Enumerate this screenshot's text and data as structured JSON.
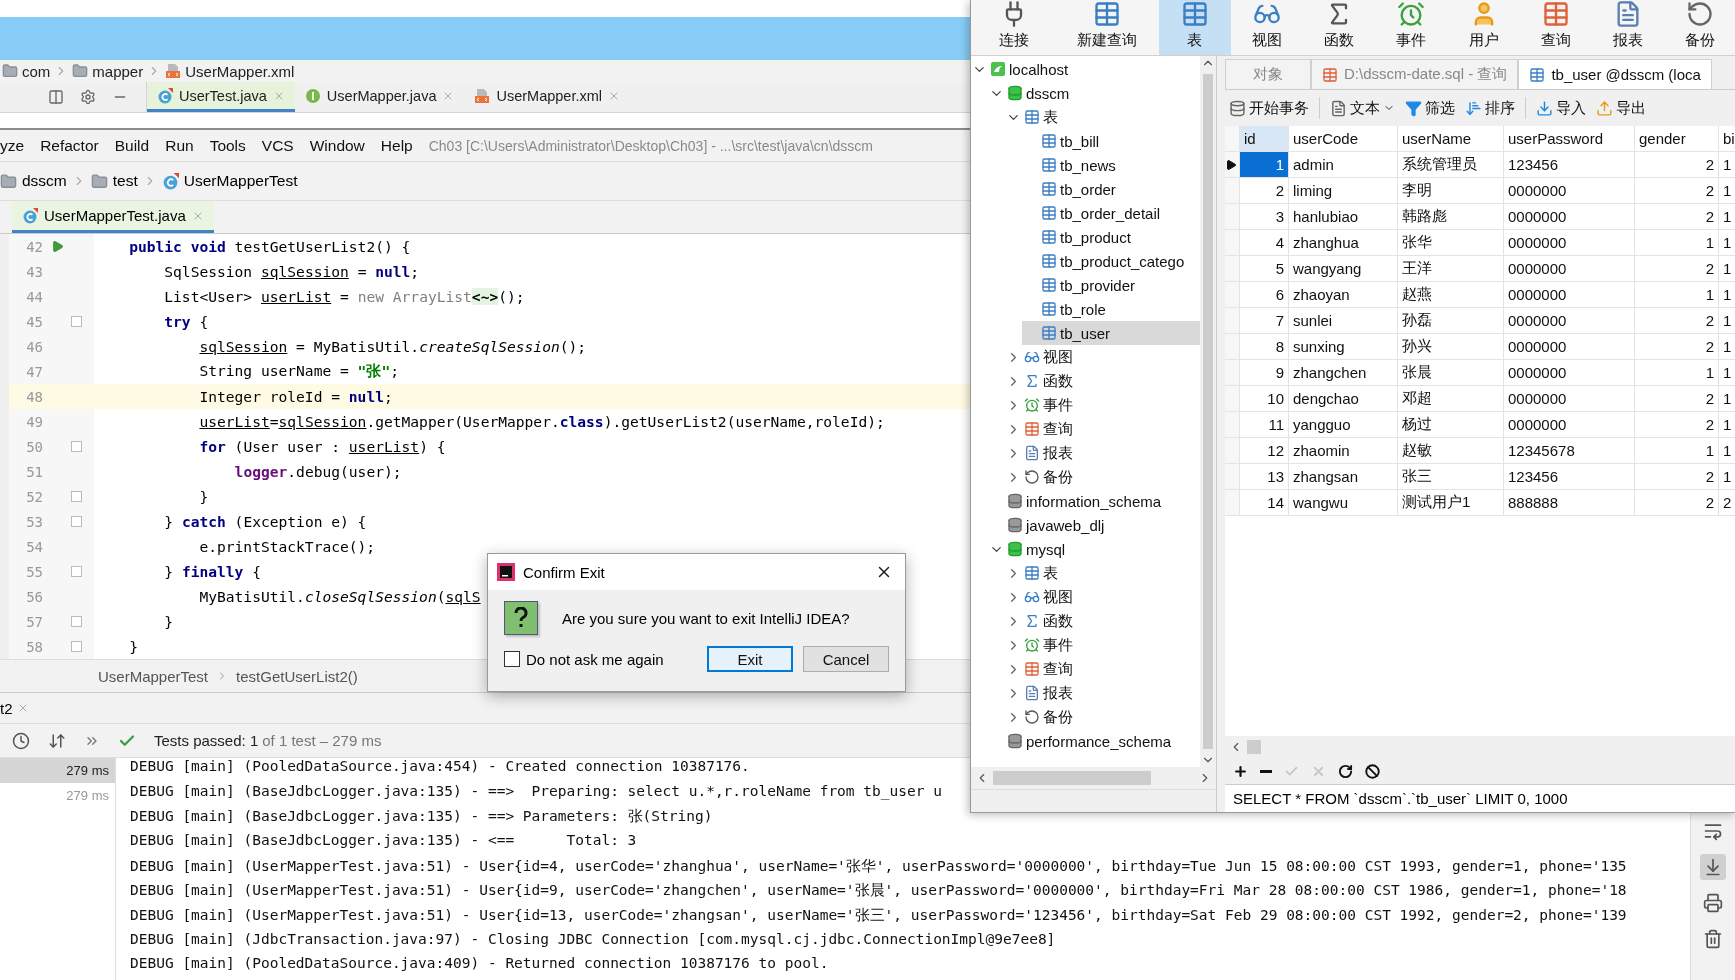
{
  "background_window": {
    "breadcrumb": [
      {
        "label": "com",
        "kind": "folder"
      },
      {
        "label": "mapper",
        "kind": "folder"
      },
      {
        "label": "UserMapper.xml",
        "kind": "xml"
      }
    ],
    "tabs": [
      {
        "label": "UserTest.java",
        "kind": "class",
        "selected": true
      },
      {
        "label": "UserMapper.java",
        "kind": "interface",
        "selected": false
      },
      {
        "label": "UserMapper.xml",
        "kind": "xml",
        "selected": false
      }
    ]
  },
  "ide": {
    "menu": [
      "yze",
      "Refactor",
      "Build",
      "Run",
      "Tools",
      "VCS",
      "Window",
      "Help"
    ],
    "title": "Ch03 [C:\\Users\\Administrator\\Desktop\\Ch03] - ...\\src\\test\\java\\cn\\dsscm",
    "breadcrumb": [
      {
        "label": "dsscm",
        "kind": "folder"
      },
      {
        "label": "test",
        "kind": "folder"
      },
      {
        "label": "UserMapperTest",
        "kind": "class"
      }
    ],
    "editor_tabs": [
      {
        "label": "UserMapperTest.java",
        "selected": true
      }
    ],
    "code": [
      {
        "number": "42",
        "highlighted": false,
        "run": true,
        "fold": false,
        "segments": [
          {
            "text": "    public void",
            "kind": "keyword"
          },
          {
            "text": " testGetUserList2() {",
            "kind": "plain"
          }
        ]
      },
      {
        "number": "43",
        "highlighted": false,
        "run": false,
        "fold": false,
        "segments": [
          {
            "text": "        SqlSession ",
            "kind": "plain"
          },
          {
            "text": "sqlSession",
            "kind": "var"
          },
          {
            "text": " = ",
            "kind": "plain"
          },
          {
            "text": "null",
            "kind": "keyword"
          },
          {
            "text": ";",
            "kind": "plain"
          }
        ]
      },
      {
        "number": "44",
        "highlighted": false,
        "run": false,
        "fold": false,
        "segments": [
          {
            "text": "        List<User> ",
            "kind": "plain"
          },
          {
            "text": "userList",
            "kind": "var"
          },
          {
            "text": " = ",
            "kind": "plain"
          },
          {
            "text": "new ArrayList",
            "kind": "dim"
          },
          {
            "text": "<~>",
            "kind": "hint"
          },
          {
            "text": "();",
            "kind": "plain"
          }
        ]
      },
      {
        "number": "45",
        "highlighted": false,
        "run": false,
        "fold": true,
        "segments": [
          {
            "text": "        try",
            "kind": "keyword"
          },
          {
            "text": " {",
            "kind": "plain"
          }
        ]
      },
      {
        "number": "46",
        "highlighted": false,
        "run": false,
        "fold": false,
        "segments": [
          {
            "text": "            sqlSession",
            "kind": "var"
          },
          {
            "text": " = MyBatisUtil.",
            "kind": "plain"
          },
          {
            "text": "createSqlSession",
            "kind": "static"
          },
          {
            "text": "();",
            "kind": "plain"
          }
        ]
      },
      {
        "number": "47",
        "highlighted": false,
        "run": false,
        "fold": false,
        "segments": [
          {
            "text": "            String userName = ",
            "kind": "plain"
          },
          {
            "text": "\"张\"",
            "kind": "string"
          },
          {
            "text": ";",
            "kind": "plain"
          }
        ]
      },
      {
        "number": "48",
        "highlighted": true,
        "run": false,
        "fold": false,
        "segments": [
          {
            "text": "            Integer roleId = ",
            "kind": "plain"
          },
          {
            "text": "null",
            "kind": "keyword"
          },
          {
            "text": ";",
            "kind": "plain"
          }
        ]
      },
      {
        "number": "49",
        "highlighted": false,
        "run": false,
        "fold": false,
        "segments": [
          {
            "text": "            userList",
            "kind": "var"
          },
          {
            "text": "=",
            "kind": "plain"
          },
          {
            "text": "sqlSession",
            "kind": "var"
          },
          {
            "text": ".getMapper(UserMapper.",
            "kind": "plain"
          },
          {
            "text": "class",
            "kind": "keyword"
          },
          {
            "text": ").getUserList2(userName,roleId);",
            "kind": "plain"
          }
        ]
      },
      {
        "number": "50",
        "highlighted": false,
        "run": false,
        "fold": true,
        "segments": [
          {
            "text": "            for",
            "kind": "keyword"
          },
          {
            "text": " (User user : ",
            "kind": "plain"
          },
          {
            "text": "userList",
            "kind": "var"
          },
          {
            "text": ") {",
            "kind": "plain"
          }
        ]
      },
      {
        "number": "51",
        "highlighted": false,
        "run": false,
        "fold": false,
        "segments": [
          {
            "text": "                logger",
            "kind": "field"
          },
          {
            "text": ".debug(user);",
            "kind": "plain"
          }
        ]
      },
      {
        "number": "52",
        "highlighted": false,
        "run": false,
        "fold": true,
        "segments": [
          {
            "text": "            }",
            "kind": "plain"
          }
        ]
      },
      {
        "number": "53",
        "highlighted": false,
        "run": false,
        "fold": true,
        "segments": [
          {
            "text": "        } ",
            "kind": "plain"
          },
          {
            "text": "catch",
            "kind": "keyword"
          },
          {
            "text": " (Exception e) {",
            "kind": "plain"
          }
        ]
      },
      {
        "number": "54",
        "highlighted": false,
        "run": false,
        "fold": false,
        "segments": [
          {
            "text": "            e.printStackTrace();",
            "kind": "plain"
          }
        ]
      },
      {
        "number": "55",
        "highlighted": false,
        "run": false,
        "fold": true,
        "segments": [
          {
            "text": "        } ",
            "kind": "plain"
          },
          {
            "text": "finally",
            "kind": "keyword"
          },
          {
            "text": " {",
            "kind": "plain"
          }
        ]
      },
      {
        "number": "56",
        "highlighted": false,
        "run": false,
        "fold": false,
        "segments": [
          {
            "text": "            MyBatisUtil.",
            "kind": "plain"
          },
          {
            "text": "closeSqlSession",
            "kind": "static"
          },
          {
            "text": "(",
            "kind": "plain"
          },
          {
            "text": "sqlS",
            "kind": "var"
          }
        ]
      },
      {
        "number": "57",
        "highlighted": false,
        "run": false,
        "fold": true,
        "segments": [
          {
            "text": "        }",
            "kind": "plain"
          }
        ]
      },
      {
        "number": "58",
        "highlighted": false,
        "run": false,
        "fold": true,
        "segments": [
          {
            "text": "    }",
            "kind": "plain"
          }
        ]
      }
    ],
    "footer_breadcrumb": [
      "UserMapperTest",
      "testGetUserList2()"
    ],
    "run_tab": "t2",
    "test_status": {
      "label": "Tests passed: 1",
      "detail": "of 1 test – 279 ms"
    },
    "test_times": [
      {
        "time": "279 ms",
        "selected": true
      },
      {
        "time": "279 ms",
        "selected": false
      }
    ],
    "console": [
      "DEBUG [main] (PooledDataSource.java:454) - Created connection 10387176.",
      "DEBUG [main] (BaseJdbcLogger.java:135) - ==>  Preparing: select u.*,r.roleName from tb_user u",
      "DEBUG [main] (BaseJdbcLogger.java:135) - ==> Parameters: 张(String)",
      "DEBUG [main] (BaseJdbcLogger.java:135) - <==      Total: 3",
      "DEBUG [main] (UserMapperTest.java:51) - User{id=4, userCode='zhanghua', userName='张华', userPassword='0000000', birthday=Tue Jun 15 08:00:00 CST 1993, gender=1, phone='135",
      "DEBUG [main] (UserMapperTest.java:51) - User{id=9, userCode='zhangchen', userName='张晨', userPassword='0000000', birthday=Fri Mar 28 08:00:00 CST 1986, gender=1, phone='18",
      "DEBUG [main] (UserMapperTest.java:51) - User{id=13, userCode='zhangsan', userName='张三', userPassword='123456', birthday=Sat Feb 29 08:00:00 CST 1992, gender=2, phone='139",
      "DEBUG [main] (JdbcTransaction.java:97) - Closing JDBC Connection [com.mysql.cj.jdbc.ConnectionImpl@9e7ee8]",
      "DEBUG [main] (PooledDataSource.java:409) - Returned connection 10387176 to pool."
    ],
    "side_tools": [
      {
        "kind": "wrap",
        "selected": false
      },
      {
        "kind": "scroll_end",
        "selected": true
      },
      {
        "kind": "print",
        "selected": false
      },
      {
        "kind": "trash",
        "selected": false
      }
    ]
  },
  "navicat": {
    "toolbar": [
      {
        "label": "连接",
        "kind": "connect",
        "selected": false
      },
      {
        "label": "新建查询",
        "kind": "new_query",
        "selected": false
      },
      {
        "label": "表",
        "kind": "tables",
        "selected": true
      },
      {
        "label": "视图",
        "kind": "views",
        "selected": false
      },
      {
        "label": "函数",
        "kind": "functions",
        "selected": false
      },
      {
        "label": "事件",
        "kind": "events",
        "selected": false
      },
      {
        "label": "用户",
        "kind": "users",
        "selected": false
      },
      {
        "label": "查询",
        "kind": "queries",
        "selected": false
      },
      {
        "label": "报表",
        "kind": "reports",
        "selected": false
      },
      {
        "label": "备份",
        "kind": "backups",
        "selected": false
      }
    ],
    "tree": [
      {
        "label": "localhost",
        "kind": "server",
        "expanded": true,
        "selected": false,
        "children": [
          {
            "label": "dsscm",
            "kind": "db_open",
            "expanded": true,
            "selected": false,
            "children": [
              {
                "label": "表",
                "kind": "tables",
                "expanded": true,
                "selected": false,
                "children": [
                  {
                    "label": "tb_bill",
                    "kind": "table",
                    "selected": false
                  },
                  {
                    "label": "tb_news",
                    "kind": "table",
                    "selected": false
                  },
                  {
                    "label": "tb_order",
                    "kind": "table",
                    "selected": false
                  },
                  {
                    "label": "tb_order_detail",
                    "kind": "table",
                    "selected": false
                  },
                  {
                    "label": "tb_product",
                    "kind": "table",
                    "selected": false
                  },
                  {
                    "label": "tb_product_catego",
                    "kind": "table",
                    "selected": false
                  },
                  {
                    "label": "tb_provider",
                    "kind": "table",
                    "selected": false
                  },
                  {
                    "label": "tb_role",
                    "kind": "table",
                    "selected": false
                  },
                  {
                    "label": "tb_user",
                    "kind": "table",
                    "selected": true
                  }
                ]
              },
              {
                "label": "视图",
                "kind": "views",
                "expanded": false,
                "selected": false
              },
              {
                "label": "函数",
                "kind": "functions",
                "expanded": false,
                "selected": false
              },
              {
                "label": "事件",
                "kind": "events",
                "expanded": false,
                "selected": false
              },
              {
                "label": "查询",
                "kind": "queries",
                "expanded": false,
                "selected": false
              },
              {
                "label": "报表",
                "kind": "reports",
                "expanded": false,
                "selected": false
              },
              {
                "label": "备份",
                "kind": "backups",
                "expanded": false,
                "selected": false
              }
            ]
          },
          {
            "label": "information_schema",
            "kind": "db",
            "selected": false
          },
          {
            "label": "javaweb_dlj",
            "kind": "db",
            "selected": false
          },
          {
            "label": "mysql",
            "kind": "db_open",
            "expanded": true,
            "selected": false,
            "children": [
              {
                "label": "表",
                "kind": "tables",
                "expanded": false,
                "selected": false
              },
              {
                "label": "视图",
                "kind": "views",
                "expanded": false,
                "selected": false
              },
              {
                "label": "函数",
                "kind": "functions",
                "expanded": false,
                "selected": false
              },
              {
                "label": "事件",
                "kind": "events",
                "expanded": false,
                "selected": false
              },
              {
                "label": "查询",
                "kind": "queries",
                "expanded": false,
                "selected": false
              },
              {
                "label": "报表",
                "kind": "reports",
                "expanded": false,
                "selected": false
              },
              {
                "label": "备份",
                "kind": "backups",
                "expanded": false,
                "selected": false
              }
            ]
          },
          {
            "label": "performance_schema",
            "kind": "db",
            "selected": false
          }
        ]
      }
    ],
    "tabs": [
      {
        "label": "对象",
        "kind": "objects",
        "selected": false
      },
      {
        "label": "D:\\dsscm-date.sql - 查询",
        "kind": "queries",
        "selected": false
      },
      {
        "label": "tb_user @dsscm (loca",
        "kind": "table",
        "selected": true
      }
    ],
    "actions": [
      {
        "label": "开始事务",
        "kind": "transaction"
      },
      {
        "label": "文本",
        "kind": "text"
      },
      {
        "label": "筛选",
        "kind": "filter"
      },
      {
        "label": "排序",
        "kind": "sort"
      },
      {
        "label": "导入",
        "kind": "import"
      },
      {
        "label": "导出",
        "kind": "export"
      }
    ],
    "table": {
      "columns": [
        "id",
        "userCode",
        "userName",
        "userPassword",
        "gender",
        "bi"
      ],
      "rows": [
        {
          "selected": true,
          "cells": [
            "1",
            "admin",
            "系统管理员",
            "123456",
            "2",
            "1"
          ]
        },
        {
          "selected": false,
          "cells": [
            "2",
            "liming",
            "李明",
            "0000000",
            "2",
            "1"
          ]
        },
        {
          "selected": false,
          "cells": [
            "3",
            "hanlubiao",
            "韩路彪",
            "0000000",
            "2",
            "1"
          ]
        },
        {
          "selected": false,
          "cells": [
            "4",
            "zhanghua",
            "张华",
            "0000000",
            "1",
            "1"
          ]
        },
        {
          "selected": false,
          "cells": [
            "5",
            "wangyang",
            "王洋",
            "0000000",
            "2",
            "1"
          ]
        },
        {
          "selected": false,
          "cells": [
            "6",
            "zhaoyan",
            "赵燕",
            "0000000",
            "1",
            "1"
          ]
        },
        {
          "selected": false,
          "cells": [
            "7",
            "sunlei",
            "孙磊",
            "0000000",
            "2",
            "1"
          ]
        },
        {
          "selected": false,
          "cells": [
            "8",
            "sunxing",
            "孙兴",
            "0000000",
            "2",
            "1"
          ]
        },
        {
          "selected": false,
          "cells": [
            "9",
            "zhangchen",
            "张晨",
            "0000000",
            "1",
            "1"
          ]
        },
        {
          "selected": false,
          "cells": [
            "10",
            "dengchao",
            "邓超",
            "0000000",
            "2",
            "1"
          ]
        },
        {
          "selected": false,
          "cells": [
            "11",
            "yangguo",
            "杨过",
            "0000000",
            "2",
            "1"
          ]
        },
        {
          "selected": false,
          "cells": [
            "12",
            "zhaomin",
            "赵敏",
            "12345678",
            "1",
            "1"
          ]
        },
        {
          "selected": false,
          "cells": [
            "13",
            "zhangsan",
            "张三",
            "123456",
            "2",
            "1"
          ]
        },
        {
          "selected": false,
          "cells": [
            "14",
            "wangwu",
            "测试用户1",
            "888888",
            "2",
            "2"
          ]
        }
      ]
    },
    "record_buttons": [
      {
        "kind": "add",
        "disabled": false
      },
      {
        "kind": "delete",
        "disabled": false
      },
      {
        "kind": "apply",
        "disabled": true
      },
      {
        "kind": "discard",
        "disabled": true
      },
      {
        "kind": "refresh",
        "disabled": false
      },
      {
        "kind": "stop",
        "disabled": false
      }
    ],
    "status": "SELECT * FROM `dsscm`.`tb_user` LIMIT 0, 1000"
  },
  "dialog": {
    "title": "Confirm Exit",
    "message": "Are you sure you want to exit IntelliJ IDEA?",
    "checkbox": {
      "label": "Do not ask me again",
      "checked": false
    },
    "buttons": [
      {
        "label": "Exit",
        "default": true
      },
      {
        "label": "Cancel",
        "default": false
      }
    ]
  }
}
